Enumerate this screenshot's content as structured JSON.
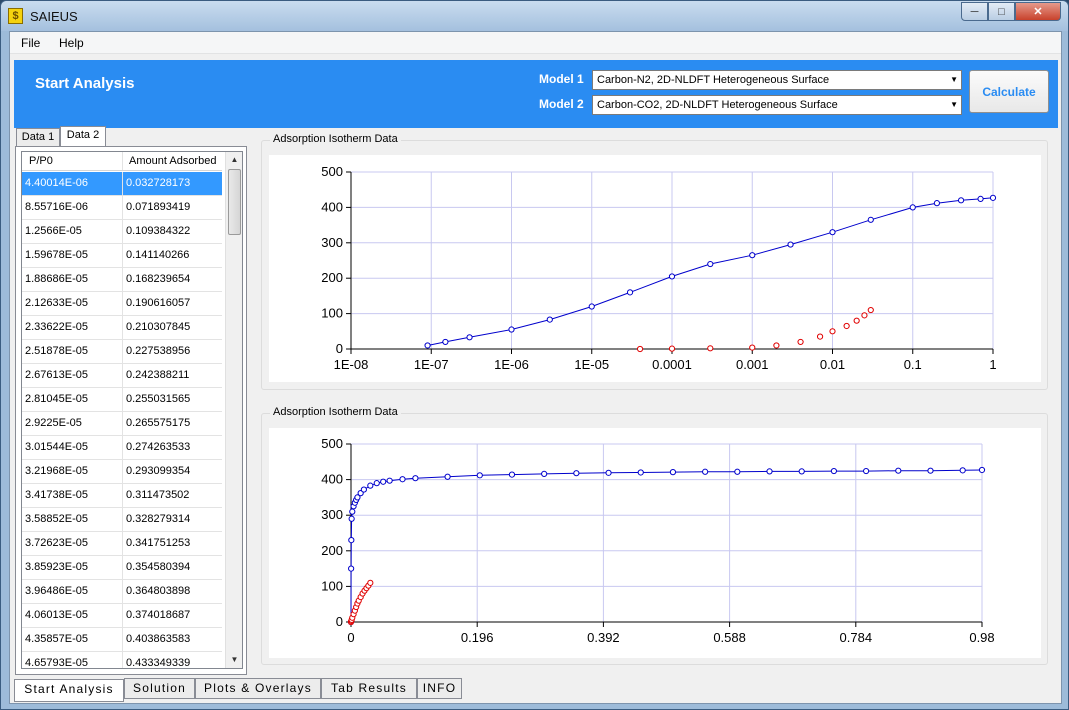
{
  "window": {
    "title": "SAIEUS"
  },
  "menu": {
    "items": [
      "File",
      "Help"
    ]
  },
  "header": {
    "title": "Start Analysis",
    "model1_label": "Model 1",
    "model1_value": "Carbon-N2, 2D-NLDFT Heterogeneous Surface",
    "model2_label": "Model 2",
    "model2_value": "Carbon-CO2, 2D-NLDFT Heterogeneous Surface",
    "calculate_label": "Calculate"
  },
  "data_tabs": [
    "Data 1",
    "Data 2"
  ],
  "table": {
    "columns": [
      "P/P0",
      "Amount Adsorbed"
    ],
    "rows": [
      [
        "4.40014E-06",
        "0.032728173"
      ],
      [
        "8.55716E-06",
        "0.071893419"
      ],
      [
        "1.2566E-05",
        "0.109384322"
      ],
      [
        "1.59678E-05",
        "0.141140266"
      ],
      [
        "1.88686E-05",
        "0.168239654"
      ],
      [
        "2.12633E-05",
        "0.190616057"
      ],
      [
        "2.33622E-05",
        "0.210307845"
      ],
      [
        "2.51878E-05",
        "0.227538956"
      ],
      [
        "2.67613E-05",
        "0.242388211"
      ],
      [
        "2.81045E-05",
        "0.255031565"
      ],
      [
        "2.9225E-05",
        "0.265575175"
      ],
      [
        "3.01544E-05",
        "0.274263533"
      ],
      [
        "3.21968E-05",
        "0.293099354"
      ],
      [
        "3.41738E-05",
        "0.311473502"
      ],
      [
        "3.58852E-05",
        "0.328279314"
      ],
      [
        "3.72623E-05",
        "0.341751253"
      ],
      [
        "3.85923E-05",
        "0.354580394"
      ],
      [
        "3.96486E-05",
        "0.364803898"
      ],
      [
        "4.06013E-05",
        "0.374018687"
      ],
      [
        "4.35857E-05",
        "0.403863583"
      ],
      [
        "4.65793E-05",
        "0.433349339"
      ]
    ]
  },
  "colors": {
    "accent": "#2a8cf2",
    "series1": "#0000cc",
    "series2": "#e00000",
    "grid": "#c8c8f0"
  },
  "chart_data": [
    {
      "type": "scatter",
      "title": "Adsorption Isotherm Data",
      "x_scale": "log",
      "xlim": [
        1e-08,
        1
      ],
      "ylim": [
        0,
        500
      ],
      "x_ticks": [
        "1E-08",
        "1E-07",
        "1E-06",
        "1E-05",
        "0.0001",
        "0.001",
        "0.01",
        "0.1",
        "1"
      ],
      "y_ticks": [
        "0",
        "100",
        "200",
        "300",
        "400",
        "500"
      ],
      "series": [
        {
          "color": "#0000cc",
          "line": true,
          "x": [
            9e-08,
            1.5e-07,
            3e-07,
            1e-06,
            3e-06,
            1e-05,
            3e-05,
            0.0001,
            0.0003,
            0.001,
            0.003,
            0.01,
            0.03,
            0.1,
            0.2,
            0.4,
            0.7,
            1
          ],
          "y": [
            10,
            20,
            33,
            55,
            83,
            120,
            160,
            205,
            240,
            265,
            295,
            330,
            365,
            400,
            412,
            420,
            424,
            427
          ]
        },
        {
          "color": "#e00000",
          "line": false,
          "x": [
            4e-05,
            0.0001,
            0.0003,
            0.001,
            0.002,
            0.004,
            0.007,
            0.01,
            0.015,
            0.02,
            0.025,
            0.03
          ],
          "y": [
            0,
            1,
            2,
            4,
            10,
            20,
            35,
            50,
            65,
            80,
            95,
            110
          ]
        }
      ]
    },
    {
      "type": "scatter",
      "title": "Adsorption Isotherm Data",
      "x_scale": "linear",
      "xlim": [
        0,
        0.98
      ],
      "ylim": [
        0,
        500
      ],
      "x_ticks": [
        "0",
        "0.196",
        "0.392",
        "0.588",
        "0.784",
        "0.98"
      ],
      "y_ticks": [
        "0",
        "100",
        "200",
        "300",
        "400",
        "500"
      ],
      "series": [
        {
          "color": "#0000cc",
          "line": true,
          "x": [
            0,
            0.0002,
            0.0005,
            0.001,
            0.002,
            0.004,
            0.006,
            0.008,
            0.01,
            0.015,
            0.02,
            0.03,
            0.04,
            0.05,
            0.06,
            0.08,
            0.1,
            0.15,
            0.2,
            0.25,
            0.3,
            0.35,
            0.4,
            0.45,
            0.5,
            0.55,
            0.6,
            0.65,
            0.7,
            0.75,
            0.8,
            0.85,
            0.9,
            0.95,
            0.98
          ],
          "y": [
            0,
            150,
            230,
            290,
            310,
            325,
            335,
            343,
            350,
            362,
            372,
            383,
            390,
            394,
            397,
            401,
            404,
            408,
            412,
            414,
            416,
            418,
            419,
            420,
            421,
            422,
            422,
            423,
            423,
            424,
            424,
            425,
            425,
            426,
            427
          ]
        },
        {
          "color": "#e00000",
          "line": false,
          "x": [
            0,
            0.0005,
            0.001,
            0.002,
            0.004,
            0.006,
            0.008,
            0.01,
            0.012,
            0.015,
            0.018,
            0.021,
            0.024,
            0.027,
            0.03
          ],
          "y": [
            0,
            3,
            6,
            12,
            22,
            32,
            42,
            52,
            60,
            70,
            80,
            88,
            95,
            102,
            110
          ]
        }
      ]
    }
  ],
  "bottom_tabs": [
    "Start Analysis",
    "Solution",
    "Plots & Overlays",
    "Tab Results",
    "INFO"
  ]
}
